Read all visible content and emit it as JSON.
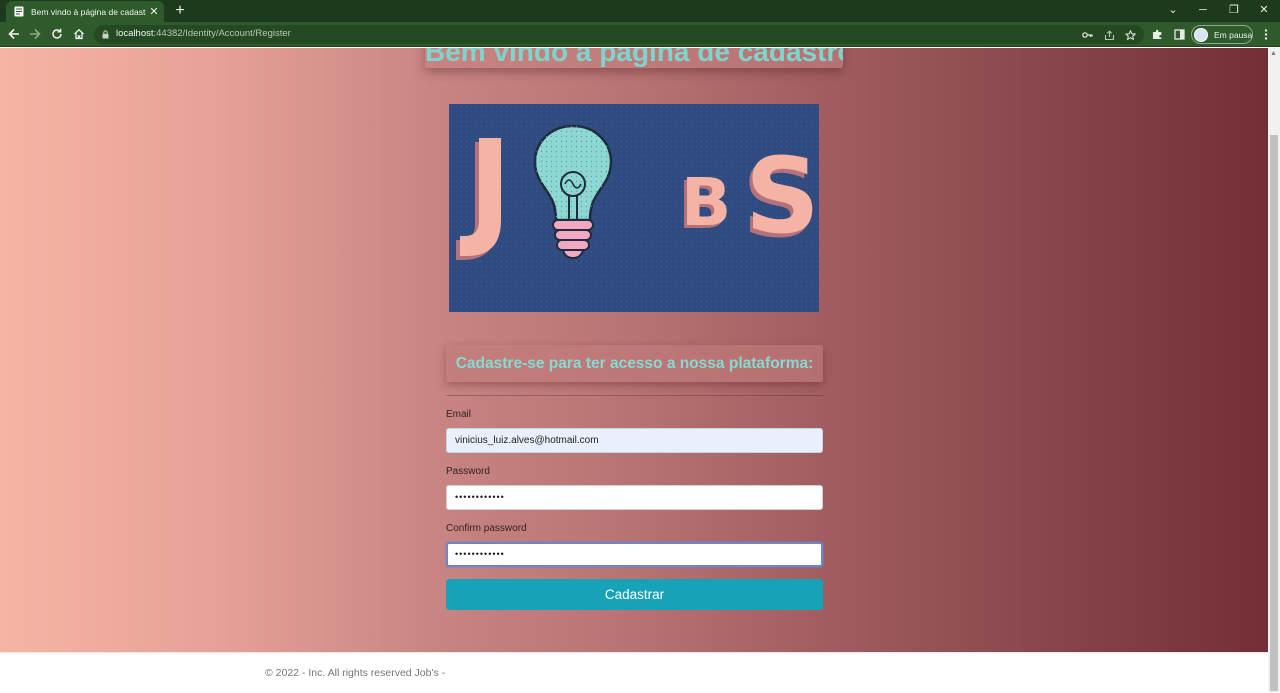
{
  "browser": {
    "tab_title": "Bem vindo à página de cadastro!",
    "tab_close_glyph": "✕",
    "new_tab_glyph": "+",
    "url_host": "localhost",
    "url_rest": ":44382/Identity/Account/Register",
    "profile_label": "Em pausa",
    "window_controls": {
      "minimize": "─",
      "restore": "❐",
      "close": "✕",
      "chevron": "⌄"
    },
    "icons": [
      "back-arrow-icon",
      "forward-arrow-icon",
      "reload-icon",
      "home-icon",
      "lock-icon",
      "key-icon",
      "share-icon",
      "star-icon",
      "extensions-puzzle-icon",
      "side-panel-icon",
      "kebab-menu-icon"
    ],
    "colors": {
      "tab_bar": "#1d3a1d",
      "toolbar": "#2f5a2c"
    }
  },
  "page": {
    "welcome_title": "Bem vindo à página de cadastro!",
    "logo": {
      "letters": [
        "J",
        "B",
        "S"
      ],
      "background": "#2f4b80",
      "letter_color": "#f4b3a5"
    },
    "subtitle": "Cadastre-se para ter acesso a nossa plataforma:",
    "form": {
      "email_label": "Email",
      "email_value": "vinicius_luiz.alves@hotmail.com",
      "password_label": "Password",
      "password_value": "••••••••••••",
      "confirm_label": "Confirm password",
      "confirm_value": "••••••••••••",
      "submit_label": "Cadastrar"
    },
    "footer": "© 2022 - Inc. All rights reserved Job's -",
    "colors": {
      "gradient_start": "#f7b4a4",
      "gradient_end": "#742e36",
      "accent_text": "#84dbd4",
      "button": "#17a2b8"
    }
  }
}
